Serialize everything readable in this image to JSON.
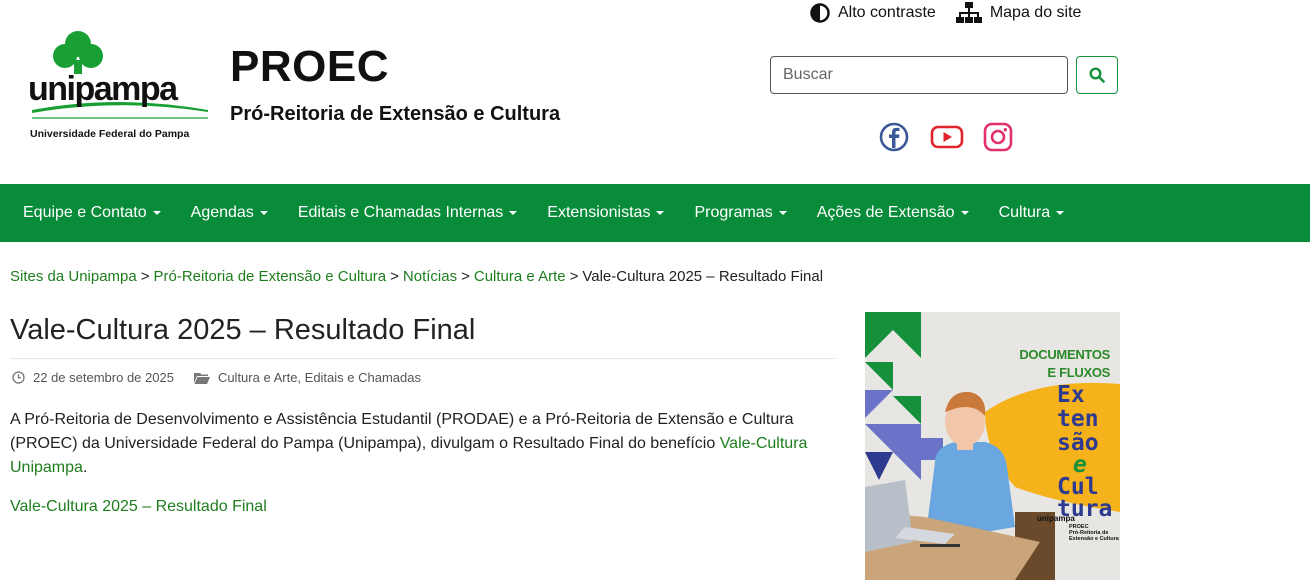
{
  "utility": {
    "contrast_label": "Alto contraste",
    "sitemap_label": "Mapa do site"
  },
  "logo": {
    "wordmark": "unipampa",
    "tagline": "Universidade Federal do Pampa"
  },
  "site": {
    "title": "PROEC",
    "subtitle": "Pró-Reitoria de Extensão e Cultura"
  },
  "search": {
    "placeholder": "Buscar"
  },
  "social": [
    "facebook-icon",
    "youtube-icon",
    "instagram-icon"
  ],
  "nav": {
    "items": [
      {
        "label": "Equipe e Contato"
      },
      {
        "label": "Agendas"
      },
      {
        "label": "Editais e Chamadas Internas"
      },
      {
        "label": "Extensionistas"
      },
      {
        "label": "Programas"
      },
      {
        "label": "Ações de Extensão"
      },
      {
        "label": "Cultura"
      }
    ]
  },
  "breadcrumb": {
    "links": [
      "Sites da Unipampa",
      "Pró-Reitoria de Extensão e Cultura",
      "Notícias",
      "Cultura e Arte"
    ],
    "separator": ">",
    "current": "Vale-Cultura 2025 – Resultado Final"
  },
  "post": {
    "title": "Vale-Cultura 2025 – Resultado Final",
    "date": "22 de setembro de 2025",
    "categories": "Cultura e Arte, Editais e Chamadas",
    "body_prefix": "A Pró-Reitoria de Desenvolvimento e Assistência Estudantil (PRODAE) e a Pró-Reitoria de Extensão e Cultura (PROEC) da Universidade Federal do Pampa (Unipampa), divulgam o Resultado Final do benefício ",
    "body_link": "Vale-Cultura Unipampa",
    "body_suffix": ".",
    "file_link": "Vale-Cultura 2025 – Resultado Final"
  },
  "banner": {
    "head_line1": "DOCUMENTOS",
    "head_line2": "E FLUXOS",
    "word_lines": [
      "Ex",
      "ten",
      "são",
      "e",
      "Cul",
      "tura"
    ],
    "logo_text": "unipampa",
    "proec_line1": "PROEC",
    "proec_line2": "Pró-Reitoria de",
    "proec_line3": "Extensão e Cultura"
  },
  "colors": {
    "nav_bg": "#088c3a",
    "link": "#1e7e1e",
    "facebook": "#3b5998",
    "youtube": "#e0242c",
    "instagram": "#e1306c"
  }
}
